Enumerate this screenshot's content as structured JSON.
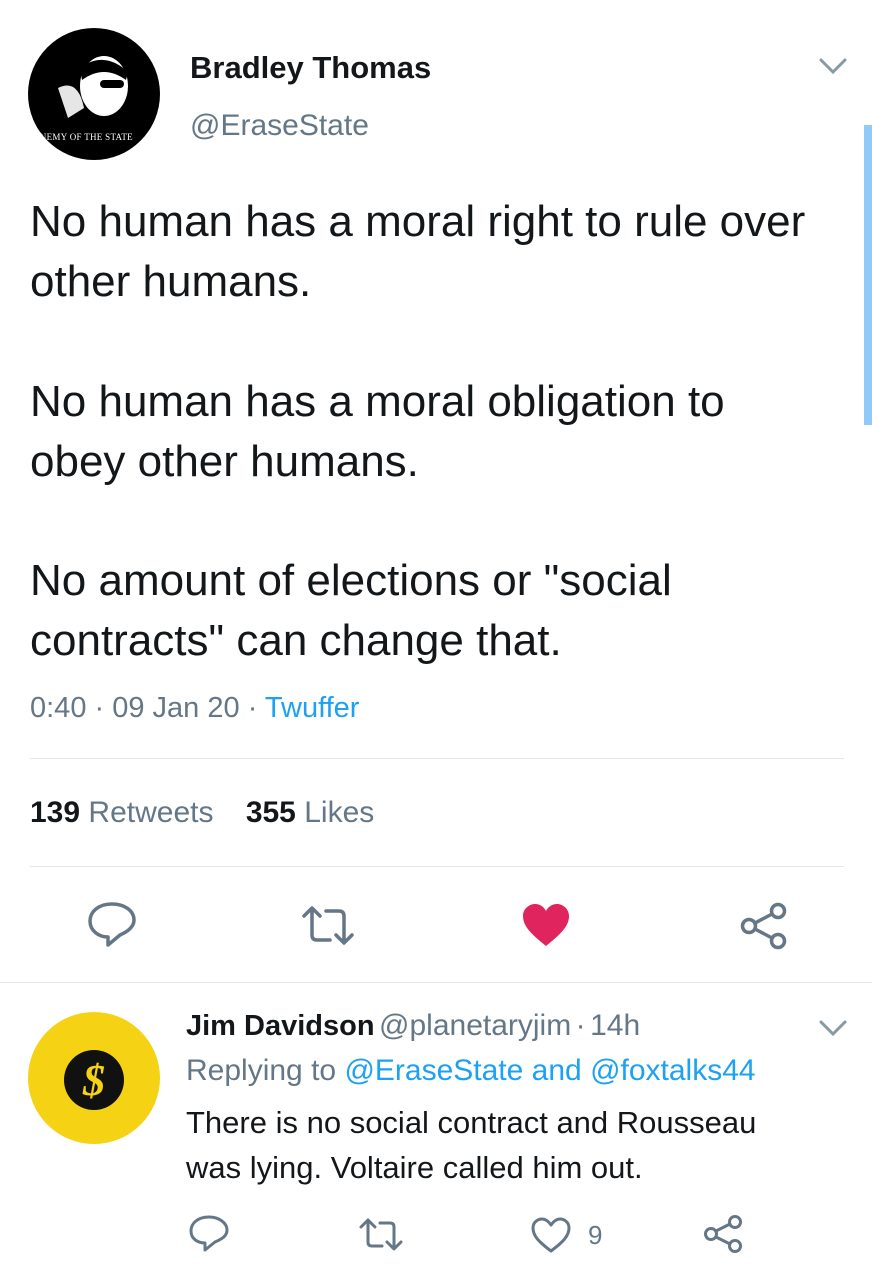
{
  "main_tweet": {
    "author_name": "Bradley Thomas",
    "author_handle": "@EraseState",
    "avatar_caption": "ENEMY OF THE STATE",
    "paragraphs": [
      "No human has a moral right to rule over other humans.",
      "No human has a moral obligation to obey other humans.",
      "No amount of elections or \"social contracts\" can change that."
    ],
    "time": "0:40",
    "date": "09 Jan 20",
    "source": "Twuffer",
    "retweet_count": "139",
    "retweet_label": "Retweets",
    "like_count": "355",
    "like_label": "Likes",
    "liked": true
  },
  "reply": {
    "author_name": "Jim Davidson",
    "author_handle": "@planetaryjim",
    "age": "14h",
    "replying_label": "Replying to",
    "reply_to_1": "@EraseState",
    "reply_and": "and",
    "reply_to_2": "@foxtalks44",
    "text": "There is no social contract and Rousseau was lying. Voltaire called him out.",
    "like_count": "9"
  },
  "colors": {
    "accent": "#1da1f2",
    "like": "#e0245e",
    "muted": "#657786",
    "reply_avatar": "#f5d214"
  },
  "icons": [
    "chevron-down-icon",
    "reply-icon",
    "retweet-icon",
    "heart-icon",
    "share-icon",
    "dollar-icon"
  ]
}
